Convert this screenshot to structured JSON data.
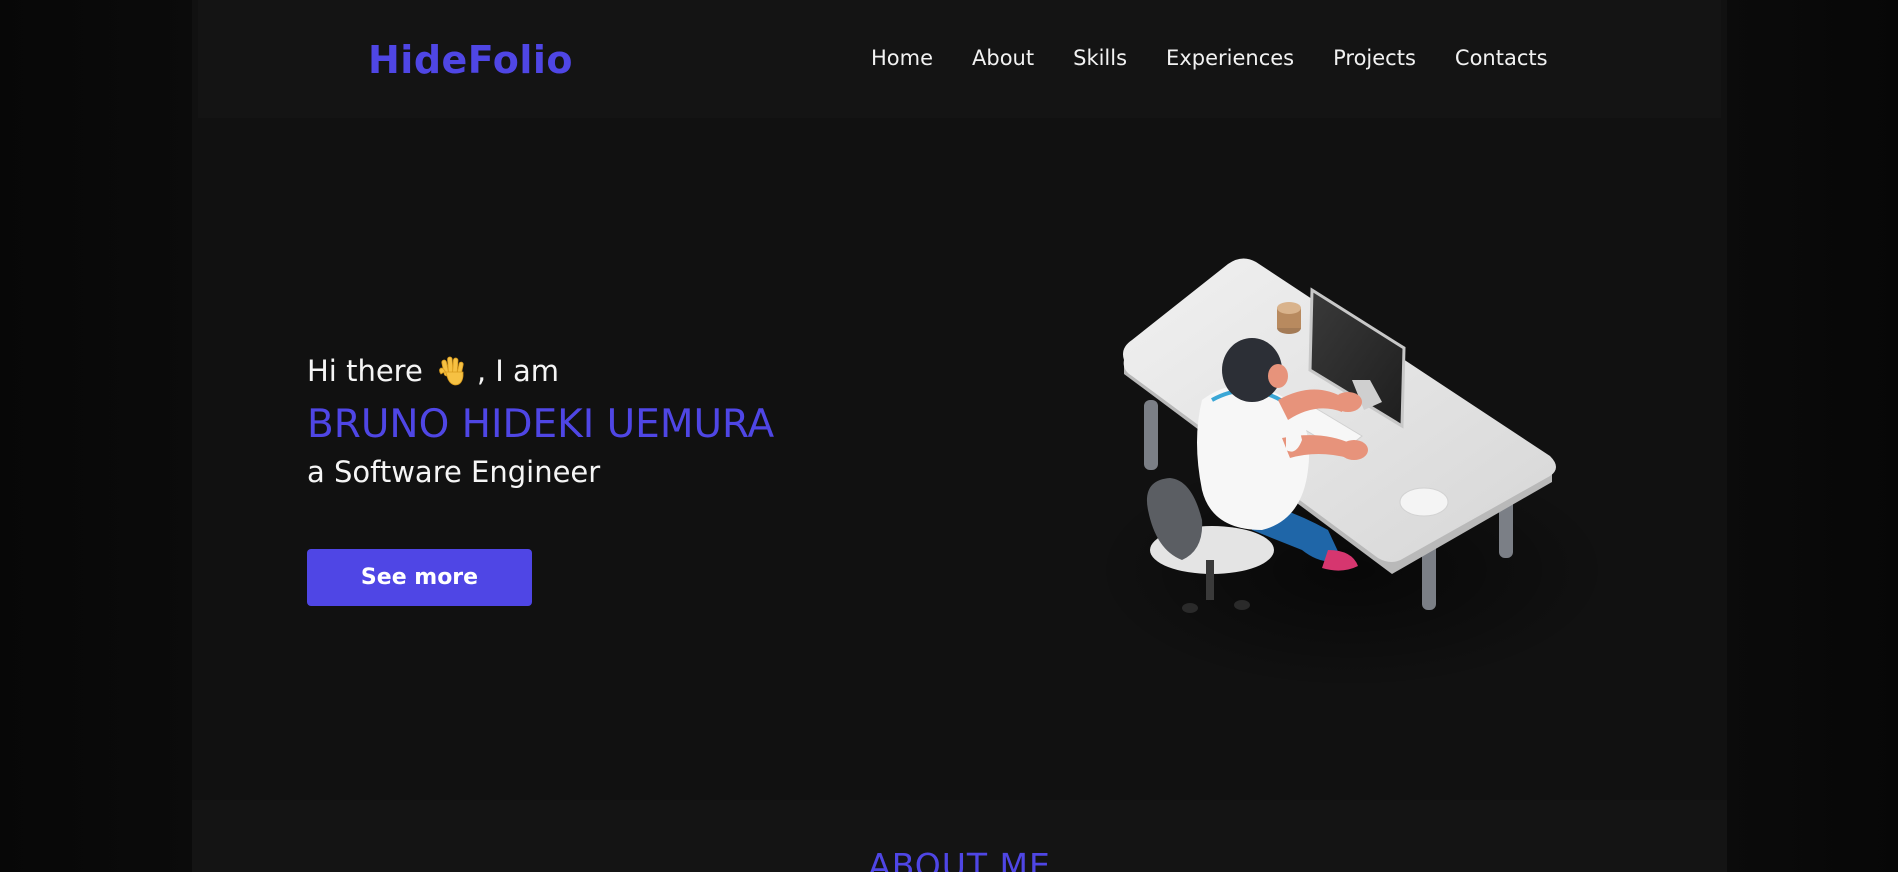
{
  "logo": "HideFolio",
  "nav": {
    "items": [
      "Home",
      "About",
      "Skills",
      "Experiences",
      "Projects",
      "Contacts"
    ]
  },
  "hero": {
    "greeting_start": "Hi there",
    "greeting_end": ", I am",
    "name": "BRUNO HIDEKI UEMURA",
    "role": "a Software Engineer",
    "button": "See more",
    "wave_icon": "waving-hand-icon",
    "illustration": "developer-at-desk-illustration"
  },
  "about": {
    "title": "ABOUT ME"
  },
  "colors": {
    "accent": "#4f46e5",
    "background": "#111111",
    "navbar": "#141414",
    "text": "#f5f5f5"
  }
}
